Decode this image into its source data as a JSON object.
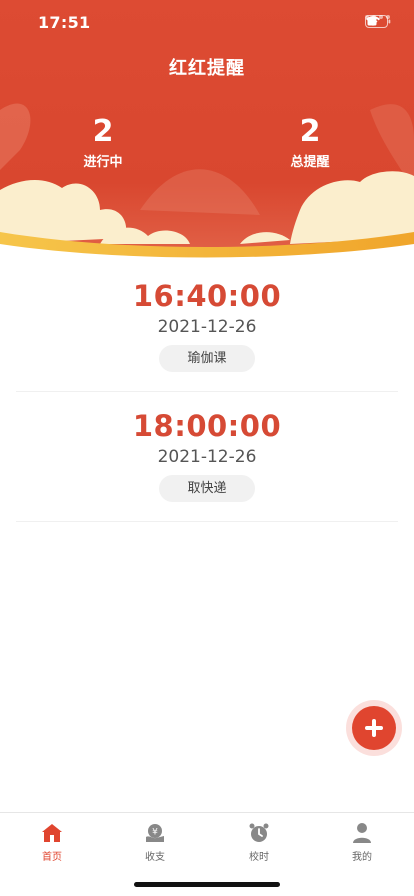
{
  "status_bar": {
    "time": "17:51"
  },
  "header": {
    "title": "红红提醒",
    "stats": [
      {
        "value": "2",
        "label": "进行中"
      },
      {
        "value": "2",
        "label": "总提醒"
      }
    ]
  },
  "reminders": [
    {
      "time": "16:40:00",
      "date": "2021-12-26",
      "tag": "瑜伽课"
    },
    {
      "time": "18:00:00",
      "date": "2021-12-26",
      "tag": "取快递"
    }
  ],
  "tabbar": {
    "tabs": [
      {
        "label": "首页",
        "icon": "home-icon",
        "active": true
      },
      {
        "label": "收支",
        "icon": "wallet-icon",
        "active": false
      },
      {
        "label": "校时",
        "icon": "alarm-clock-icon",
        "active": false
      },
      {
        "label": "我的",
        "icon": "user-icon",
        "active": false
      }
    ]
  },
  "colors": {
    "accent": "#e0452f",
    "header_red": "#db4a32",
    "cloud": "#fbeecd",
    "gold": "#f2b233"
  }
}
